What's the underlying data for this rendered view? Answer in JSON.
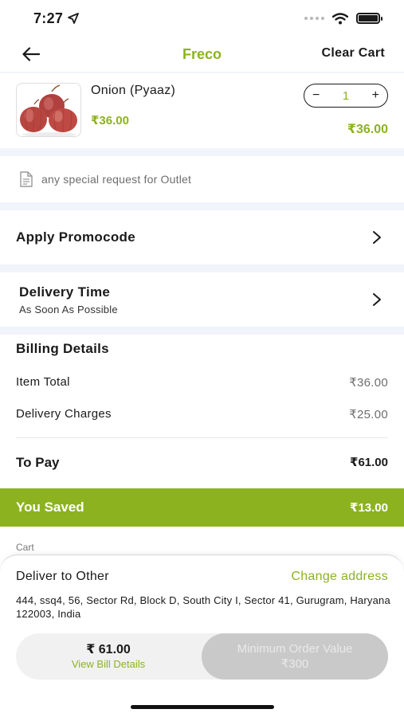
{
  "status_bar": {
    "time": "7:27"
  },
  "header": {
    "title": "Freco",
    "clear_cart": "Clear Cart"
  },
  "cart_item": {
    "name": "Onion (Pyaaz)",
    "unit_price": "₹36.00",
    "quantity": "1",
    "decrement": "−",
    "increment": "+",
    "line_total": "₹36.00"
  },
  "special_request": {
    "placeholder": "any special request for Outlet"
  },
  "promocode": {
    "label": "Apply Promocode"
  },
  "delivery_time": {
    "label": "Delivery Time",
    "value": "As Soon As Possible"
  },
  "billing": {
    "title": "Billing Details",
    "item_total_label": "Item Total",
    "item_total_value": "₹36.00",
    "delivery_label": "Delivery Charges",
    "delivery_value": "₹25.00",
    "to_pay_label": "To Pay",
    "to_pay_value": "₹61.00"
  },
  "savings": {
    "label": "You Saved",
    "value": "₹13.00"
  },
  "cart_label": "Cart",
  "delivery": {
    "title": "Deliver to Other",
    "change": "Change address",
    "address": "444, ssq4, 56, Sector Rd, Block D, South City I, Sector 41, Gurugram, Haryana 122003, India"
  },
  "checkout": {
    "amount": "₹ 61.00",
    "view_bill": "View Bill Details",
    "min_order_line1": "Minimum Order Value",
    "min_order_line2": "₹300"
  },
  "colors": {
    "accent": "#8cb31f",
    "band": "#f2f4fb",
    "disabled": "#c9c9c9"
  }
}
